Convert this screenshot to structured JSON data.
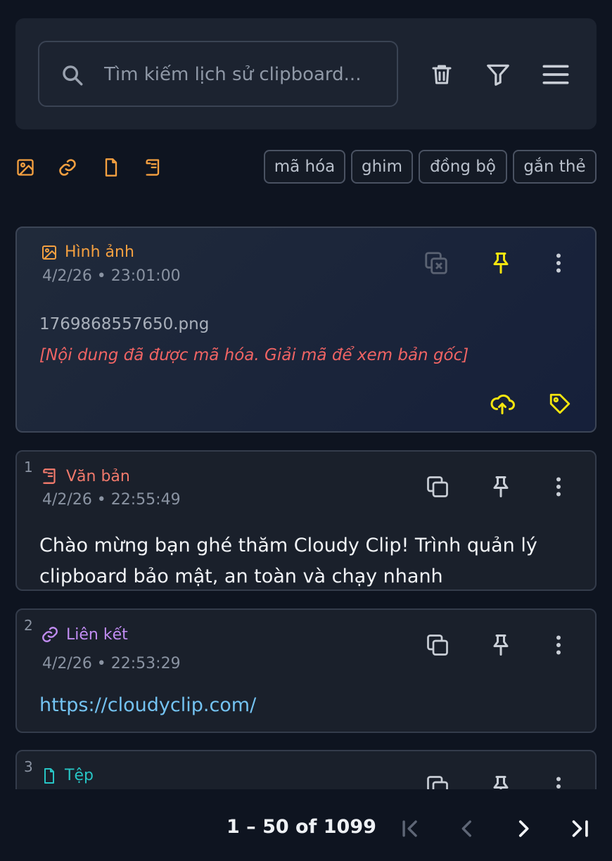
{
  "search": {
    "placeholder": "Tìm kiếm lịch sử clipboard..."
  },
  "filters": {
    "types": [
      "image-filter",
      "link-filter",
      "file-filter",
      "text-filter"
    ],
    "chips": [
      "mã hóa",
      "ghim",
      "đồng bộ",
      "gắn thẻ"
    ]
  },
  "cards": [
    {
      "index": "",
      "type_label": "Hình ảnh",
      "timestamp": "4/2/26 • 23:01:00",
      "filename": "1769868557650.png",
      "encrypted_note": "[Nội dung đã được mã hóa. Giải mã để xem bản gốc]"
    },
    {
      "index": "1",
      "type_label": "Văn bản",
      "timestamp": "4/2/26 • 22:55:49",
      "content": "Chào mừng bạn ghé thăm Cloudy Clip! Trình quản lý clipboard bảo mật, an toàn và chạy nhanh"
    },
    {
      "index": "2",
      "type_label": "Liên kết",
      "timestamp": "4/2/26 • 22:53:29",
      "content": "https://cloudyclip.com/"
    },
    {
      "index": "3",
      "type_label": "Tệp"
    }
  ],
  "pagination": {
    "range": "1 – 50 of 1099"
  },
  "colors": {
    "image": "#f5a040",
    "text": "#f27a6c",
    "link": "#c18cf2",
    "file": "#27c4c4",
    "pin_active": "#f5e50f",
    "encrypted": "#f06464",
    "link_text": "#74c3f2"
  }
}
